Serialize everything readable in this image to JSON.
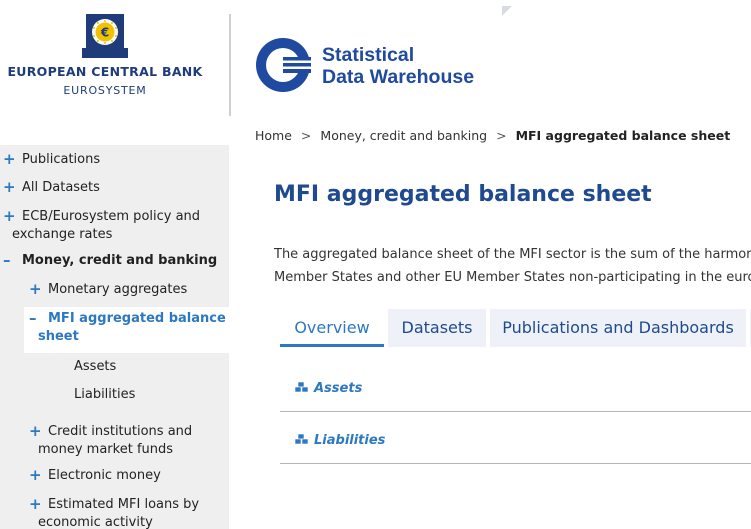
{
  "header": {
    "ecb_name": "EUROPEAN CENTRAL BANK",
    "ecb_sub": "EUROSYSTEM",
    "sdw_line1": "Statistical",
    "sdw_line2": "Data Warehouse"
  },
  "breadcrumb": {
    "items": [
      "Home",
      "Money, credit and banking"
    ],
    "current": "MFI aggregated balance sheet"
  },
  "sidebar": {
    "items": [
      {
        "label": "Publications",
        "marker": "+"
      },
      {
        "label": "All Datasets",
        "marker": "+"
      },
      {
        "label": "ECB/Eurosystem policy and",
        "label2": "exchange rates",
        "marker": "+"
      },
      {
        "label": "Money, credit and banking",
        "marker": "–"
      },
      {
        "label": "Monetary aggregates",
        "marker": "+"
      },
      {
        "label": "MFI aggregated balance",
        "label2": "sheet",
        "marker": "–"
      },
      {
        "label": "Assets"
      },
      {
        "label": "Liabilities"
      },
      {
        "label": "Credit institutions and",
        "label2": "money market funds",
        "marker": "+"
      },
      {
        "label": "Electronic money",
        "marker": "+"
      },
      {
        "label": "Estimated MFI loans by",
        "label2": "economic activity",
        "marker": "+"
      }
    ]
  },
  "main": {
    "title": "MFI aggregated balance sheet",
    "intro_line1": "The aggregated balance sheet of the MFI sector is the sum of the harmor",
    "intro_line2": "Member States and other EU Member States non-participating in the euro",
    "tabs": [
      "Overview",
      "Datasets",
      "Publications and Dashboards"
    ],
    "active_tab": "Overview",
    "links": [
      "Assets",
      "Liabilities"
    ]
  },
  "colors": {
    "brand_blue": "#1f4a8f",
    "link_blue": "#2c78c2",
    "sidebar_bg": "#efefef"
  },
  "icons": [
    "ecb-emblem-icon",
    "sdw-logo-icon",
    "plus-icon",
    "minus-icon",
    "dataset-cubes-icon"
  ]
}
